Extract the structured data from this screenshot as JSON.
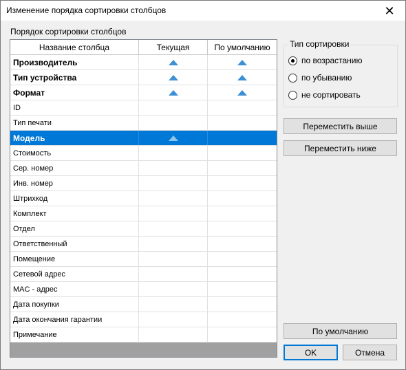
{
  "window": {
    "title": "Изменение порядка сортировки столбцов",
    "close_glyph": "✕"
  },
  "list": {
    "label": "Порядок сортировки столбцов",
    "columns": [
      "Название столбца",
      "Текущая",
      "По умолчанию"
    ],
    "sort_icon": "sort-ascending-icon",
    "rows": [
      {
        "name": "Производитель",
        "current": "asc",
        "default": "asc",
        "bold": true,
        "selected": false
      },
      {
        "name": "Тип устройства",
        "current": "asc",
        "default": "asc",
        "bold": true,
        "selected": false
      },
      {
        "name": "Формат",
        "current": "asc",
        "default": "asc",
        "bold": true,
        "selected": false
      },
      {
        "name": "ID",
        "current": "",
        "default": "",
        "bold": false,
        "selected": false
      },
      {
        "name": "Тип печати",
        "current": "",
        "default": "",
        "bold": false,
        "selected": false
      },
      {
        "name": "Модель",
        "current": "asc",
        "default": "",
        "bold": true,
        "selected": true
      },
      {
        "name": "Стоимость",
        "current": "",
        "default": "",
        "bold": false,
        "selected": false
      },
      {
        "name": "Сер. номер",
        "current": "",
        "default": "",
        "bold": false,
        "selected": false
      },
      {
        "name": "Инв. номер",
        "current": "",
        "default": "",
        "bold": false,
        "selected": false
      },
      {
        "name": "Штрихкод",
        "current": "",
        "default": "",
        "bold": false,
        "selected": false
      },
      {
        "name": "Комплект",
        "current": "",
        "default": "",
        "bold": false,
        "selected": false
      },
      {
        "name": "Отдел",
        "current": "",
        "default": "",
        "bold": false,
        "selected": false
      },
      {
        "name": "Ответственный",
        "current": "",
        "default": "",
        "bold": false,
        "selected": false
      },
      {
        "name": "Помещение",
        "current": "",
        "default": "",
        "bold": false,
        "selected": false
      },
      {
        "name": "Сетевой адрес",
        "current": "",
        "default": "",
        "bold": false,
        "selected": false
      },
      {
        "name": "MAC - адрес",
        "current": "",
        "default": "",
        "bold": false,
        "selected": false
      },
      {
        "name": "Дата покупки",
        "current": "",
        "default": "",
        "bold": false,
        "selected": false
      },
      {
        "name": "Дата окончания гарантии",
        "current": "",
        "default": "",
        "bold": false,
        "selected": false
      },
      {
        "name": "Примечание",
        "current": "",
        "default": "",
        "bold": false,
        "selected": false
      }
    ]
  },
  "sort_type": {
    "title": "Тип сортировки",
    "options": [
      "по возрастанию",
      "по убыванию",
      "не сортировать"
    ],
    "selected_index": 0
  },
  "buttons": {
    "move_up": "Переместить выше",
    "move_down": "Переместить ниже",
    "defaults": "По умолчанию",
    "ok": "OK",
    "cancel": "Отмена"
  },
  "colors": {
    "selection": "#0078d7",
    "arrow_fill": "#3d8fd6",
    "arrow_fill_light": "#8ec5ef"
  }
}
